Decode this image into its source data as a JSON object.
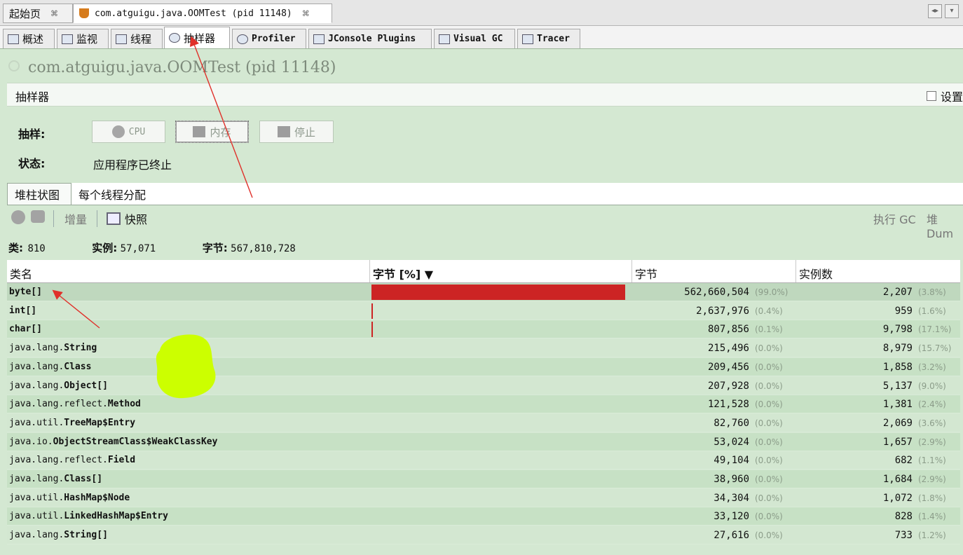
{
  "doc_tabs": [
    {
      "label": "起始页",
      "close": "⌘",
      "active": false
    },
    {
      "label": "com.atguigu.java.OOMTest (pid 11148)",
      "close": "⌘",
      "active": true
    }
  ],
  "tool_tabs": [
    {
      "label": "概述",
      "icon": "overview-icon"
    },
    {
      "label": "监视",
      "icon": "monitor-icon"
    },
    {
      "label": "线程",
      "icon": "threads-icon"
    },
    {
      "label": "抽样器",
      "icon": "sampler-icon",
      "active": true
    },
    {
      "label": "Profiler",
      "icon": "profiler-icon"
    },
    {
      "label": "JConsole Plugins",
      "icon": "jconsole-icon"
    },
    {
      "label": "Visual GC",
      "icon": "visual-gc-icon"
    },
    {
      "label": "Tracer",
      "icon": "tracer-icon"
    }
  ],
  "app_title": "com.atguigu.java.OOMTest (pid 11148)",
  "section_title": "抽样器",
  "settings_label": "设置",
  "sampling": {
    "label": "抽样:",
    "cpu": "CPU",
    "memory": "内存",
    "stop": "停止"
  },
  "status": {
    "label": "状态:",
    "value": "应用程序已终止"
  },
  "sub_tabs": [
    "堆柱状图",
    "每个线程分配"
  ],
  "toolbar": {
    "delta": "增量",
    "snapshot": "快照",
    "gc": "执行 GC",
    "dump": "堆 Dum"
  },
  "summary": {
    "classes_label": "类:",
    "classes": "810",
    "instances_label": "实例:",
    "instances": "57,071",
    "bytes_label": "字节:",
    "bytes": "567,810,728"
  },
  "columns": [
    "类名",
    "字节 [%] ▼",
    "字节",
    "实例数"
  ],
  "rows": [
    {
      "pkg": "",
      "cls": "byte[]",
      "pct": 99.0,
      "bytes": "562,660,504",
      "bytes_pct": "(99.0%)",
      "inst": "2,207",
      "inst_pct": "(3.8%)"
    },
    {
      "pkg": "",
      "cls": "int[]",
      "pct": 0.4,
      "bytes": "2,637,976",
      "bytes_pct": "(0.4%)",
      "inst": "959",
      "inst_pct": "(1.6%)"
    },
    {
      "pkg": "",
      "cls": "char[]",
      "pct": 0.1,
      "bytes": "807,856",
      "bytes_pct": "(0.1%)",
      "inst": "9,798",
      "inst_pct": "(17.1%)"
    },
    {
      "pkg": "java.lang.",
      "cls": "String",
      "pct": 0,
      "bytes": "215,496",
      "bytes_pct": "(0.0%)",
      "inst": "8,979",
      "inst_pct": "(15.7%)"
    },
    {
      "pkg": "java.lang.",
      "cls": "Class",
      "pct": 0,
      "bytes": "209,456",
      "bytes_pct": "(0.0%)",
      "inst": "1,858",
      "inst_pct": "(3.2%)"
    },
    {
      "pkg": "java.lang.",
      "cls": "Object[]",
      "pct": 0,
      "bytes": "207,928",
      "bytes_pct": "(0.0%)",
      "inst": "5,137",
      "inst_pct": "(9.0%)"
    },
    {
      "pkg": "java.lang.reflect.",
      "cls": "Method",
      "pct": 0,
      "bytes": "121,528",
      "bytes_pct": "(0.0%)",
      "inst": "1,381",
      "inst_pct": "(2.4%)"
    },
    {
      "pkg": "java.util.",
      "cls": "TreeMap$Entry",
      "pct": 0,
      "bytes": "82,760",
      "bytes_pct": "(0.0%)",
      "inst": "2,069",
      "inst_pct": "(3.6%)"
    },
    {
      "pkg": "java.io.",
      "cls": "ObjectStreamClass$WeakClassKey",
      "pct": 0,
      "bytes": "53,024",
      "bytes_pct": "(0.0%)",
      "inst": "1,657",
      "inst_pct": "(2.9%)"
    },
    {
      "pkg": "java.lang.reflect.",
      "cls": "Field",
      "pct": 0,
      "bytes": "49,104",
      "bytes_pct": "(0.0%)",
      "inst": "682",
      "inst_pct": "(1.1%)"
    },
    {
      "pkg": "java.lang.",
      "cls": "Class[]",
      "pct": 0,
      "bytes": "38,960",
      "bytes_pct": "(0.0%)",
      "inst": "1,684",
      "inst_pct": "(2.9%)"
    },
    {
      "pkg": "java.util.",
      "cls": "HashMap$Node",
      "pct": 0,
      "bytes": "34,304",
      "bytes_pct": "(0.0%)",
      "inst": "1,072",
      "inst_pct": "(1.8%)"
    },
    {
      "pkg": "java.util.",
      "cls": "LinkedHashMap$Entry",
      "pct": 0,
      "bytes": "33,120",
      "bytes_pct": "(0.0%)",
      "inst": "828",
      "inst_pct": "(1.4%)"
    },
    {
      "pkg": "java.lang.",
      "cls": "String[]",
      "pct": 0,
      "bytes": "27,616",
      "bytes_pct": "(0.0%)",
      "inst": "733",
      "inst_pct": "(1.2%)"
    }
  ],
  "colors": {
    "bar": "#cc2424",
    "panel": "#d4e8d2",
    "highlight": "#ccff00",
    "annotation": "#e0302a"
  }
}
